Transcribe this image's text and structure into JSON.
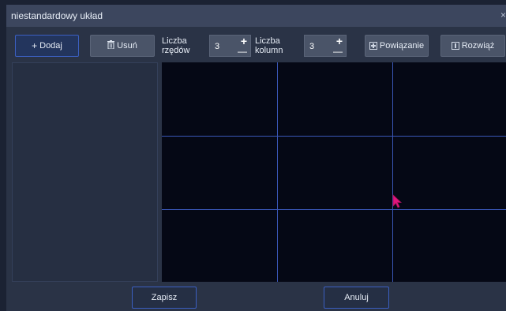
{
  "window": {
    "title": "niestandardowy układ",
    "close_glyph": "×"
  },
  "toolbar": {
    "add_label": "Dodaj",
    "add_icon": "plus-icon",
    "remove_label": "Usuń",
    "remove_icon": "trash-icon",
    "rows_label_line1": "Liczba",
    "rows_label_line2": "rzędów",
    "rows_value": "3",
    "cols_label_line1": "Liczba",
    "cols_label_line2": "kolumn",
    "cols_value": "3",
    "merge_label": "Powiązanie",
    "merge_icon": "merge-icon",
    "split_label": "Rozwiąż",
    "split_icon": "split-icon",
    "plus_glyph": "+",
    "minus_glyph": "—"
  },
  "layout_grid": {
    "rows": 3,
    "columns": 3
  },
  "footer": {
    "save_label": "Zapisz",
    "cancel_label": "Anuluj"
  },
  "colors": {
    "accent": "#3b5fc1",
    "grid_line": "#3a57b8",
    "grid_bg": "#050815",
    "cursor": "#e0157c"
  }
}
